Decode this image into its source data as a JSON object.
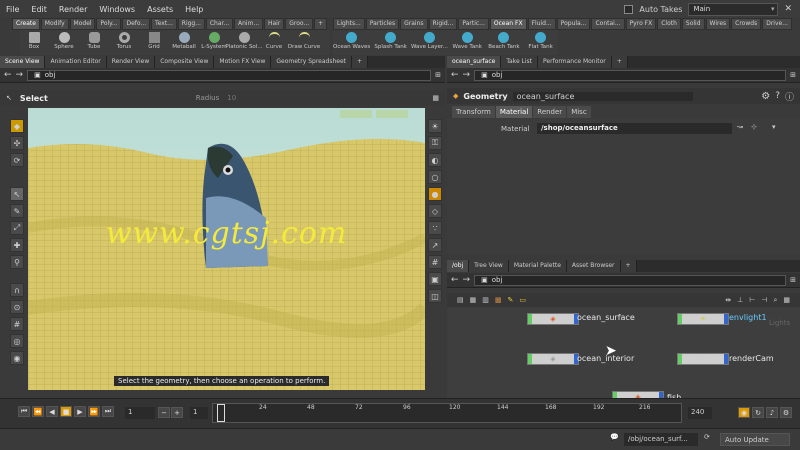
{
  "menu": [
    "File",
    "Edit",
    "Render",
    "Windows",
    "Assets",
    "Help"
  ],
  "auto_takes_label": "Auto Takes",
  "desktop": "Main",
  "shelf_left": [
    "Create",
    "Modify",
    "Model",
    "Poly...",
    "Defo...",
    "Text...",
    "Rigg...",
    "Char...",
    "Anim...",
    "Hair",
    "Groo..."
  ],
  "shelf_right": [
    "Lights...",
    "Particles",
    "Grains",
    "Rigid...",
    "Partic...",
    "Ocean FX",
    "Fluid...",
    "Popula...",
    "Contai...",
    "Pyro FX",
    "Cloth",
    "Solid",
    "Wires",
    "Crowds",
    "Drive..."
  ],
  "tools_left": [
    "Box",
    "Sphere",
    "Tube",
    "Torus",
    "Grid",
    "Metaball",
    "L-System",
    "Platonic Sol...",
    "Curve",
    "Draw Curve"
  ],
  "tools_right": [
    "Ocean Waves",
    "Splash Tank",
    "Wave Layer...",
    "Wave Tank",
    "Beach Tank",
    "Flat Tank"
  ],
  "left_tabs": [
    "Scene View",
    "Animation Editor",
    "Render View",
    "Composite View",
    "Motion FX View",
    "Geometry Spreadsheet"
  ],
  "obj": "obj",
  "tool_title": "Select",
  "radius_label": "Radius",
  "radius_val": "10",
  "watermark": "www.cgtsj.com",
  "hint": "Select the geometry, then choose an operation to perform.",
  "param_tabs": [
    "ocean_surface",
    "Take List",
    "Performance Monitor"
  ],
  "geo_label": "Geometry",
  "geo_name": "ocean_surface",
  "sub_tabs": [
    "Transform",
    "Material",
    "Render",
    "Misc"
  ],
  "material_label": "Material",
  "material_val": "/shop/oceansurface",
  "net_tabs": [
    "/obj",
    "Tree View",
    "Material Palette",
    "Asset Browser"
  ],
  "nodes": {
    "n1": "ocean_surface",
    "n2": "envlight1",
    "n3": "ocean_interior",
    "n4": "renderCam",
    "n5": "fish",
    "n6": "Lights"
  },
  "timeline": {
    "frame": "1",
    "start": "1",
    "end": "240",
    "ticks": [
      "24",
      "48",
      "72",
      "96",
      "120",
      "144",
      "168",
      "192",
      "216"
    ]
  },
  "status": {
    "path": "/obj/ocean_surf...",
    "update": "Auto Update"
  }
}
